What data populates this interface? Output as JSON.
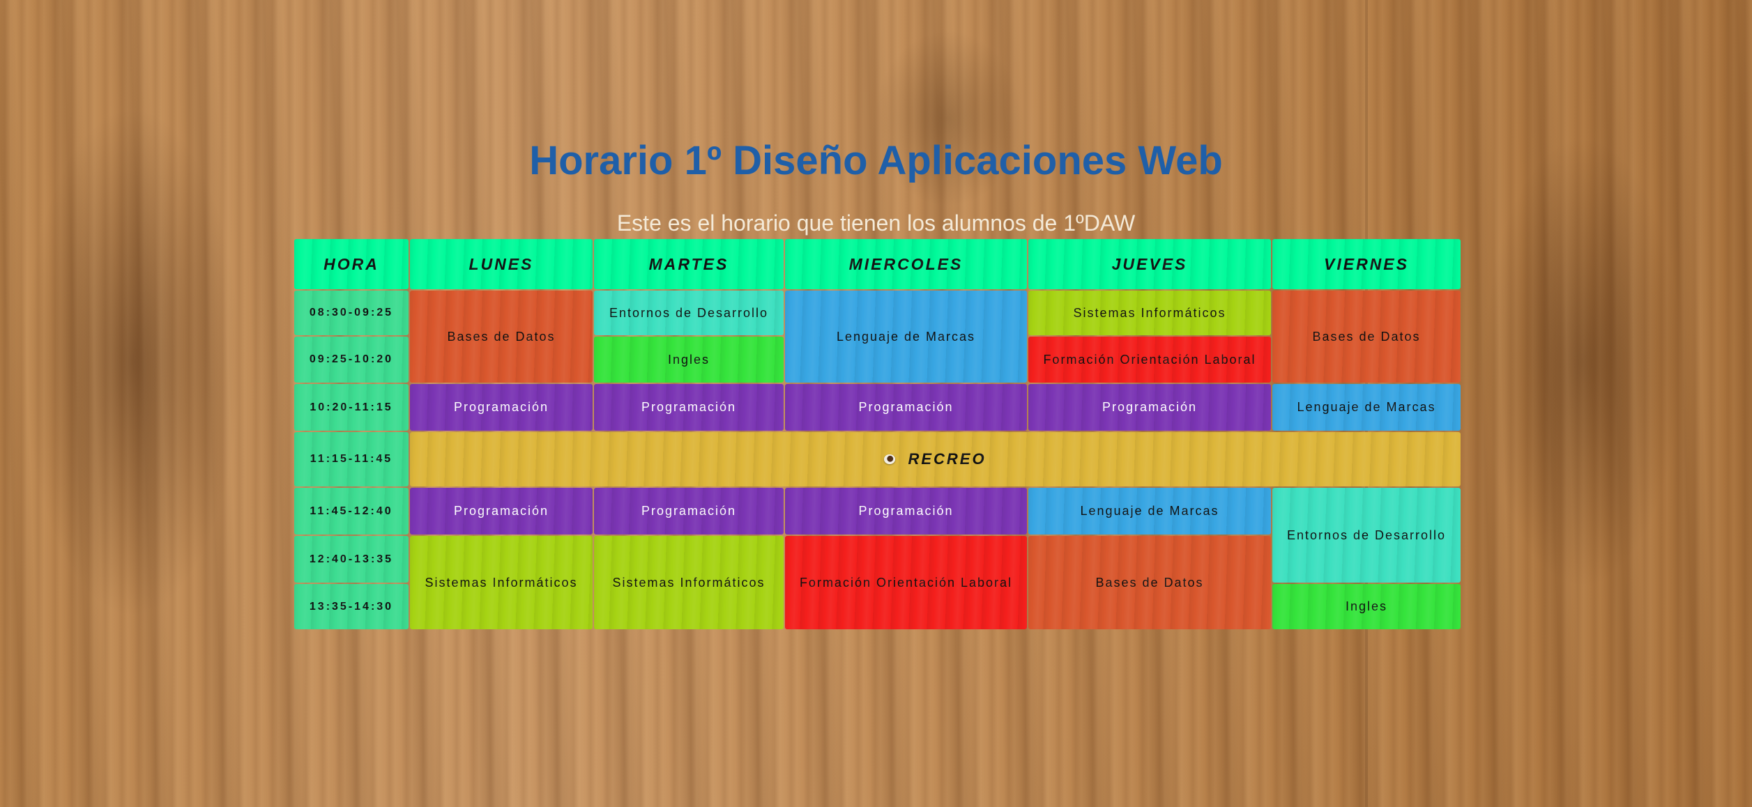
{
  "title": "Horario 1º Diseño Aplicaciones Web",
  "subtitle": "Este es el horario que tienen los alumnos de 1ºDAW",
  "headers": [
    "HORA",
    "LUNES",
    "MARTES",
    "MIERCOLES",
    "JUEVES",
    "VIERNES"
  ],
  "times": [
    "08:30-09:25",
    "09:25-10:20",
    "10:20-11:15",
    "11:15-11:45",
    "11:45-12:40",
    "12:40-13:35",
    "13:35-14:30"
  ],
  "colors": {
    "header": "#00fa9a",
    "hora": "#3ddc91",
    "bases_de_datos": "#d9572d",
    "entornos_de_desarrollo": "#3de0c0",
    "ingles": "#35e43c",
    "lenguaje_de_marcas": "#38a6e3",
    "sistemas_informaticos": "#a6d313",
    "formacion_orientacion_laboral": "#f41f1c",
    "programacion": "#7b35b4",
    "recreo": "#ddb63a"
  },
  "subjects": {
    "bases_de_datos": "Bases de Datos",
    "entornos_de_desarrollo": "Entornos de Desarrollo",
    "ingles": "Ingles",
    "lenguaje_de_marcas": "Lenguaje de Marcas",
    "sistemas_informaticos": "Sistemas Informáticos",
    "formacion_orientacion_laboral": "Formación Orientación Laboral",
    "programacion": "Programación"
  },
  "recreo": {
    "label": "RECREO",
    "icon": "coffee-cup-icon"
  }
}
